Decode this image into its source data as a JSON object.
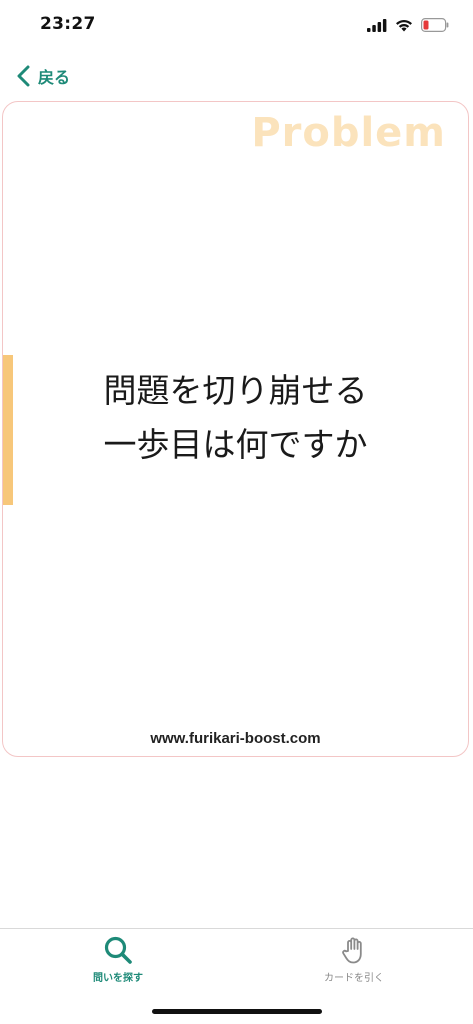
{
  "status_bar": {
    "time": "23:27",
    "icons": [
      "cellular-signal-icon",
      "wifi-icon",
      "battery-low-icon"
    ]
  },
  "nav": {
    "back_label": "戻る"
  },
  "card": {
    "tag": "Problem",
    "question_line1": "問題を切り崩せる",
    "question_line2": "一歩目は何ですか",
    "footer_url": "www.furikari-boost.com"
  },
  "tab_bar": {
    "tabs": [
      {
        "label": "問いを探す",
        "icon": "search-icon",
        "active": true
      },
      {
        "label": "カードを引く",
        "icon": "hand-icon",
        "active": false
      }
    ]
  },
  "colors": {
    "accent": "#1e8a78",
    "card_border": "#f3c6c6",
    "tag_color": "#fbe3bc",
    "side_marker": "#f7c77a",
    "inactive_tab": "#8a8a8a"
  }
}
